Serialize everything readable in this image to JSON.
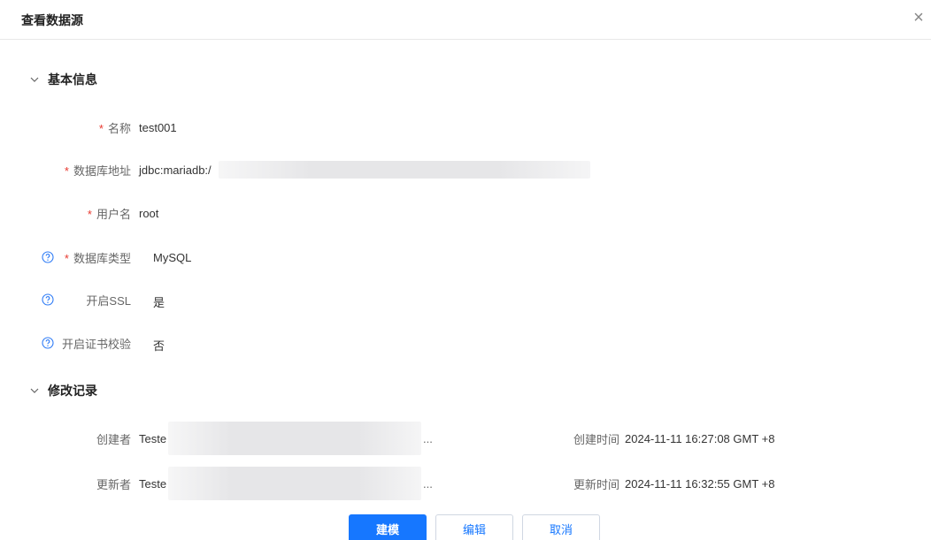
{
  "dialog": {
    "title": "查看数据源",
    "close_glyph": "×"
  },
  "basic_info": {
    "section_title": "基本信息",
    "required_mark": "*",
    "name": {
      "label": "名称",
      "value": "test001"
    },
    "db_url": {
      "label": "数据库地址",
      "value": "jdbc:mariadb:/"
    },
    "username": {
      "label": "用户名",
      "value": "root"
    },
    "db_type": {
      "label": "数据库类型",
      "value": "MySQL"
    },
    "ssl": {
      "label": "开启SSL",
      "value": "是"
    },
    "cert_check": {
      "label": "开启证书校验",
      "value": "否"
    }
  },
  "history": {
    "section_title": "修改记录",
    "creator": {
      "label": "创建者",
      "value": "Teste",
      "ellipsis": "..."
    },
    "updater": {
      "label": "更新者",
      "value": "Teste",
      "ellipsis": "..."
    },
    "created_time": {
      "label": "创建时间",
      "value": "2024-11-11 16:27:08 GMT +8"
    },
    "updated_time": {
      "label": "更新时间",
      "value": "2024-11-11 16:32:55 GMT +8"
    }
  },
  "footer": {
    "model_label": "建模",
    "edit_label": "编辑",
    "cancel_label": "取消"
  },
  "colors": {
    "primary": "#1677ff",
    "required": "#e8392f",
    "icon": "#2f7cf6"
  },
  "icons": [
    "close-icon",
    "chevron-down-icon",
    "question-circle-icon"
  ]
}
